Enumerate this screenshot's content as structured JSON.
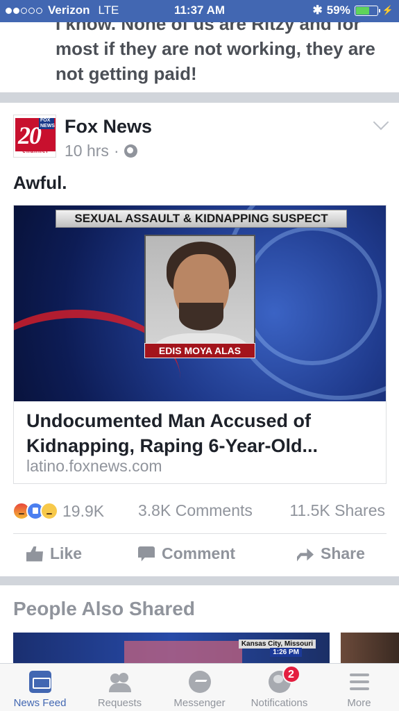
{
  "status_bar": {
    "carrier": "Verizon",
    "network": "LTE",
    "time": "11:37 AM",
    "battery": "59%",
    "battery_level": 0.59
  },
  "previous_post": {
    "text": "I know. None of us are Ritzy and for most if they are not working, they are not getting paid!"
  },
  "post": {
    "author": "Fox News",
    "avatar_text": "20",
    "avatar_tag": "FOX NEWS",
    "avatar_channel": "channel",
    "timestamp": "10 hrs",
    "separator": "·",
    "message": "Awful.",
    "link": {
      "banner": "SEXUAL ASSAULT & KIDNAPPING SUSPECT",
      "name_plate": "EDIS MOYA ALAS",
      "title": "Undocumented Man Accused of Kidnapping, Raping 6-Year-Old...",
      "domain": "latino.foxnews.com"
    },
    "reactions_count": "19.9K",
    "comments_count": "3.8K Comments",
    "shares_count": "11.5K Shares",
    "actions": {
      "like": "Like",
      "comment": "Comment",
      "share": "Share"
    }
  },
  "also_shared": {
    "heading": "People Also Shared",
    "thumb_location": "Kansas City, Missouri",
    "thumb_time": "1:26 PM"
  },
  "tab_bar": {
    "news_feed": "News Feed",
    "requests": "Requests",
    "messenger": "Messenger",
    "notifications": "Notifications",
    "notifications_badge": "2",
    "more": "More"
  },
  "colors": {
    "brand_blue": "#4267b2",
    "badge_red": "#e41e3f",
    "muted_gray": "#90949c"
  }
}
